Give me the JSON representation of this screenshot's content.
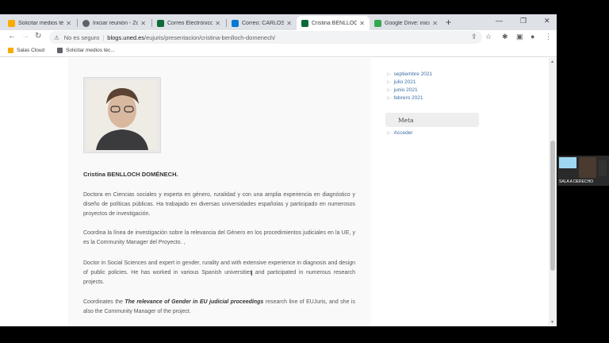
{
  "tabs": [
    {
      "title": "Solicitar medios téc...",
      "color": "#f9ab00"
    },
    {
      "title": "Iniciar reunión - Zo...",
      "color": "#5f6368"
    },
    {
      "title": "Correo Electrónico ...",
      "color": "#0b6b3a"
    },
    {
      "title": "Correo: CARLOS AM...",
      "color": "#0078d4"
    },
    {
      "title": "Cristina BENLLOCH ...",
      "color": "#0b6b3a"
    },
    {
      "title": "Google Drive: inicio ...",
      "color": "#34a853"
    }
  ],
  "toolbar": {
    "security_label": "No es seguro",
    "url_host": "blogs.uned.es",
    "url_path": "/eujuris/presentacion/cristina-benlloch-domenech/"
  },
  "bookmarks": [
    {
      "label": "Salas Cloud",
      "color": "#f9ab00"
    },
    {
      "label": "Solicitar medios téc...",
      "color": "#5f6368"
    }
  ],
  "sidebar": {
    "archive_links": [
      "septiembre 2021",
      "julio 2021",
      "junio 2021",
      "febrero 2021"
    ],
    "meta_title": "Meta",
    "meta_links": [
      "Acceder"
    ]
  },
  "content": {
    "name": "Cristina BENLLOCH DOMÉNECH.",
    "p1": "Doctora en Ciencias sociales y experta en género, ruralidad y con una amplia experiencia en diagnóstico y diseño de políticas públicas. Ha trabajado en diversas universidades españolas y participado en numerosos proyectos de investigación.",
    "p2": "Coordina la línea de investigación sobre la relevancia del Género en los procedimientos judiciales en la UE, y es la Community Manager del Proyecto. ,",
    "p3": "Doctor in Social Sciences and expert in gender, rurality and with extensive experience in diagnosis and design of public policies. He has worked in various Spanish universities and participated in numerous research projects.",
    "p4_pre": "Coordinates the ",
    "p4_bold": "The relevance of Gender in EU judicial proceedings",
    "p4_post": " research line of EUJuris, and she is also the Community Manager of the project."
  },
  "video": {
    "label": "SALA A DERECHO"
  }
}
